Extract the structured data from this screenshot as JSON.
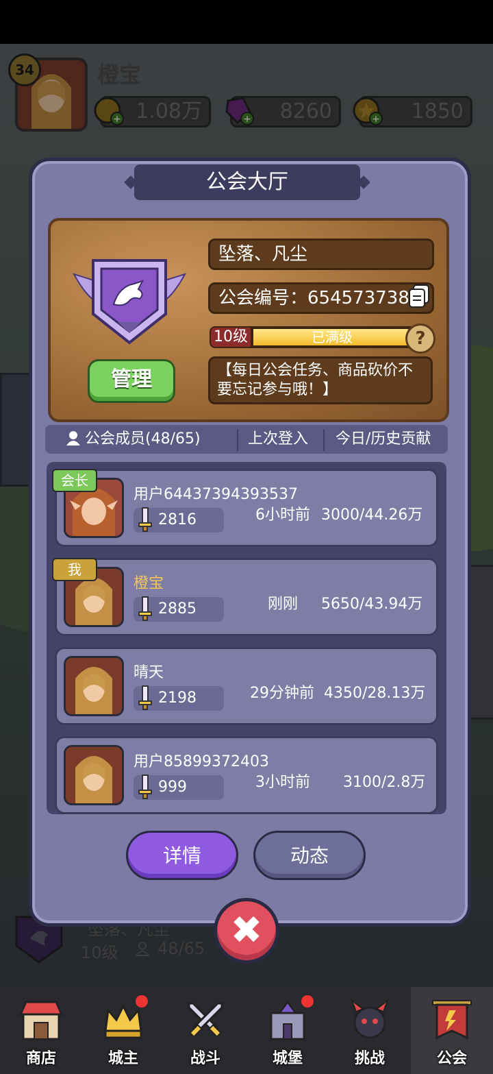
{
  "player": {
    "level": "34",
    "name": "橙宝",
    "resources": [
      {
        "icon": "coin-icon",
        "value": "1.08万",
        "color": "#8a6a1f"
      },
      {
        "icon": "gem-icon",
        "value": "8260",
        "color": "#7a2a8a"
      },
      {
        "icon": "star-coin-icon",
        "value": "1850",
        "color": "#8a6a1f"
      }
    ]
  },
  "modal": {
    "title": "公会大厅",
    "guild": {
      "name": "坠落、凡尘",
      "id_label": "公会编号：654573738",
      "level_tag": "10级",
      "level_status": "已满级",
      "level_progress": 1.0,
      "notice": "【每日公会任务、商品砍价不要忘记参与哦！】",
      "manage_label": "管理"
    },
    "header": {
      "members": "公会成员(48/65)",
      "last_login": "上次登入",
      "contribution": "今日/历史贡献"
    },
    "members": [
      {
        "tag": "会长",
        "name": "用户64437394393537",
        "power": "2816",
        "time": "6小时前",
        "contrib": "3000/44.26万",
        "is_me": false
      },
      {
        "tag": "我",
        "name": "橙宝",
        "power": "2885",
        "time": "刚刚",
        "contrib": "5650/43.94万",
        "is_me": true
      },
      {
        "tag": "",
        "name": "晴天",
        "power": "2198",
        "time": "29分钟前",
        "contrib": "4350/28.13万",
        "is_me": false
      },
      {
        "tag": "",
        "name": "用户85899372403",
        "power": "999",
        "time": "3小时前",
        "contrib": "3100/2.8万",
        "is_me": false
      }
    ],
    "buttons": {
      "detail": "详情",
      "activity": "动态"
    }
  },
  "background_guild": {
    "name": "坠落、凡尘",
    "level": "10级",
    "members": "48/65"
  },
  "nav": [
    {
      "label": "商店",
      "icon": "shop-icon",
      "badge": false,
      "active": false
    },
    {
      "label": "城主",
      "icon": "crown-icon",
      "badge": true,
      "active": false
    },
    {
      "label": "战斗",
      "icon": "swords-icon",
      "badge": false,
      "active": false
    },
    {
      "label": "城堡",
      "icon": "castle-icon",
      "badge": true,
      "active": false
    },
    {
      "label": "挑战",
      "icon": "demon-icon",
      "badge": false,
      "active": false
    },
    {
      "label": "公会",
      "icon": "banner-icon",
      "badge": false,
      "active": true
    }
  ],
  "colors": {
    "accent_purple": "#8f5be0",
    "close_red": "#e1505f",
    "manage_green": "#7bd25e",
    "me_name": "#f4c659",
    "leader_tag": "#7cc85a",
    "me_tag": "#c9a23a"
  }
}
